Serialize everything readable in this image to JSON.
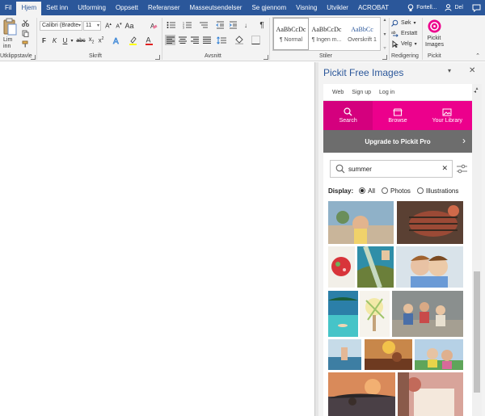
{
  "menu": {
    "tabs": [
      "Fil",
      "Hjem",
      "Sett inn",
      "Utforming",
      "Oppsett",
      "Referanser",
      "Masseutsendelser",
      "Se gjennom",
      "Visning",
      "Utvikler",
      "ACROBAT"
    ],
    "active_index": 1,
    "tell_me": "Fortell...",
    "share": "Del"
  },
  "ribbon": {
    "clipboard": {
      "paste_line1": "Lim",
      "paste_line2": "inn",
      "group_label": "Utklippstavle"
    },
    "font": {
      "name": "Calibri (Brødte",
      "size": "11",
      "group_label": "Skrift"
    },
    "paragraph": {
      "group_label": "Avsnitt"
    },
    "styles": {
      "items": [
        {
          "sample": "AaBbCcDc",
          "name": "¶ Normal"
        },
        {
          "sample": "AaBbCcDc",
          "name": "¶ Ingen m..."
        },
        {
          "sample": "AaBbCc",
          "name": "Overskrift 1"
        }
      ],
      "group_label": "Stiler"
    },
    "editing": {
      "find": "Søk",
      "replace": "Erstatt",
      "select": "Velg",
      "group_label": "Redigering"
    },
    "pickit": {
      "line1": "Pickit",
      "line2": "Images",
      "group_label": "Pickit"
    }
  },
  "pane": {
    "title": "Pickit Free Images",
    "links": [
      "Web",
      "Sign up",
      "Log in"
    ],
    "nav": [
      "Search",
      "Browse",
      "Your Library"
    ],
    "nav_active": 0,
    "upgrade": "Upgrade to Pickit Pro",
    "search_value": "summer",
    "display_label": "Display:",
    "display_options": [
      "All",
      "Photos",
      "Illustrations"
    ],
    "display_selected": 0
  },
  "colors": {
    "word_blue": "#2b579a",
    "pickit_pink": "#ec008c",
    "upgrade_gray": "#6d6d6d"
  }
}
